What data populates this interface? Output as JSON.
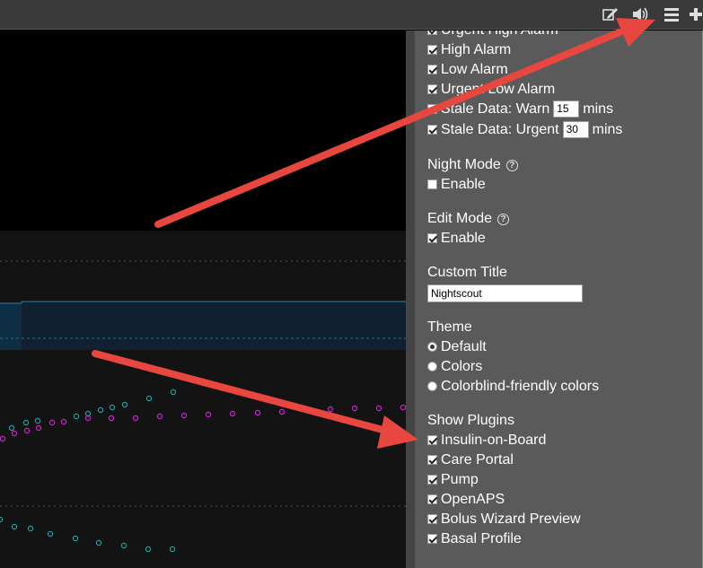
{
  "toolbar": {
    "edit_icon": "edit-icon",
    "speaker_icon": "speaker-icon",
    "menu_icon": "hamburger-menu-icon",
    "plus_icon": "plus-icon"
  },
  "alarms": {
    "urgent_high": {
      "label": "Urgent High Alarm",
      "checked": true
    },
    "high": {
      "label": "High Alarm",
      "checked": true
    },
    "low": {
      "label": "Low Alarm",
      "checked": true
    },
    "urgent_low": {
      "label": "Urgent Low Alarm",
      "checked": true
    },
    "stale_warn": {
      "label": "Stale Data: Warn",
      "value": "15",
      "unit": "mins",
      "checked": true
    },
    "stale_urgent": {
      "label": "Stale Data: Urgent",
      "value": "30",
      "unit": "mins",
      "checked": true
    }
  },
  "night_mode": {
    "title": "Night Mode",
    "enable_label": "Enable",
    "checked": false
  },
  "edit_mode": {
    "title": "Edit Mode",
    "enable_label": "Enable",
    "checked": true
  },
  "custom_title": {
    "title": "Custom Title",
    "value": "Nightscout"
  },
  "theme": {
    "title": "Theme",
    "options": [
      "Default",
      "Colors",
      "Colorblind-friendly colors"
    ],
    "selected": "Default"
  },
  "plugins": {
    "title": "Show Plugins",
    "items": [
      {
        "label": "Insulin-on-Board",
        "checked": true
      },
      {
        "label": "Care Portal",
        "checked": true
      },
      {
        "label": "Pump",
        "checked": true
      },
      {
        "label": "OpenAPS",
        "checked": true
      },
      {
        "label": "Bolus Wizard Preview",
        "checked": true
      },
      {
        "label": "Basal Profile",
        "checked": true
      }
    ]
  },
  "help_glyph": "?",
  "colors": {
    "arrow": "#e8473f",
    "magenta_points": "#d020d0",
    "teal_points": "#20a0a0",
    "basal_band": "#0f2a3a"
  }
}
